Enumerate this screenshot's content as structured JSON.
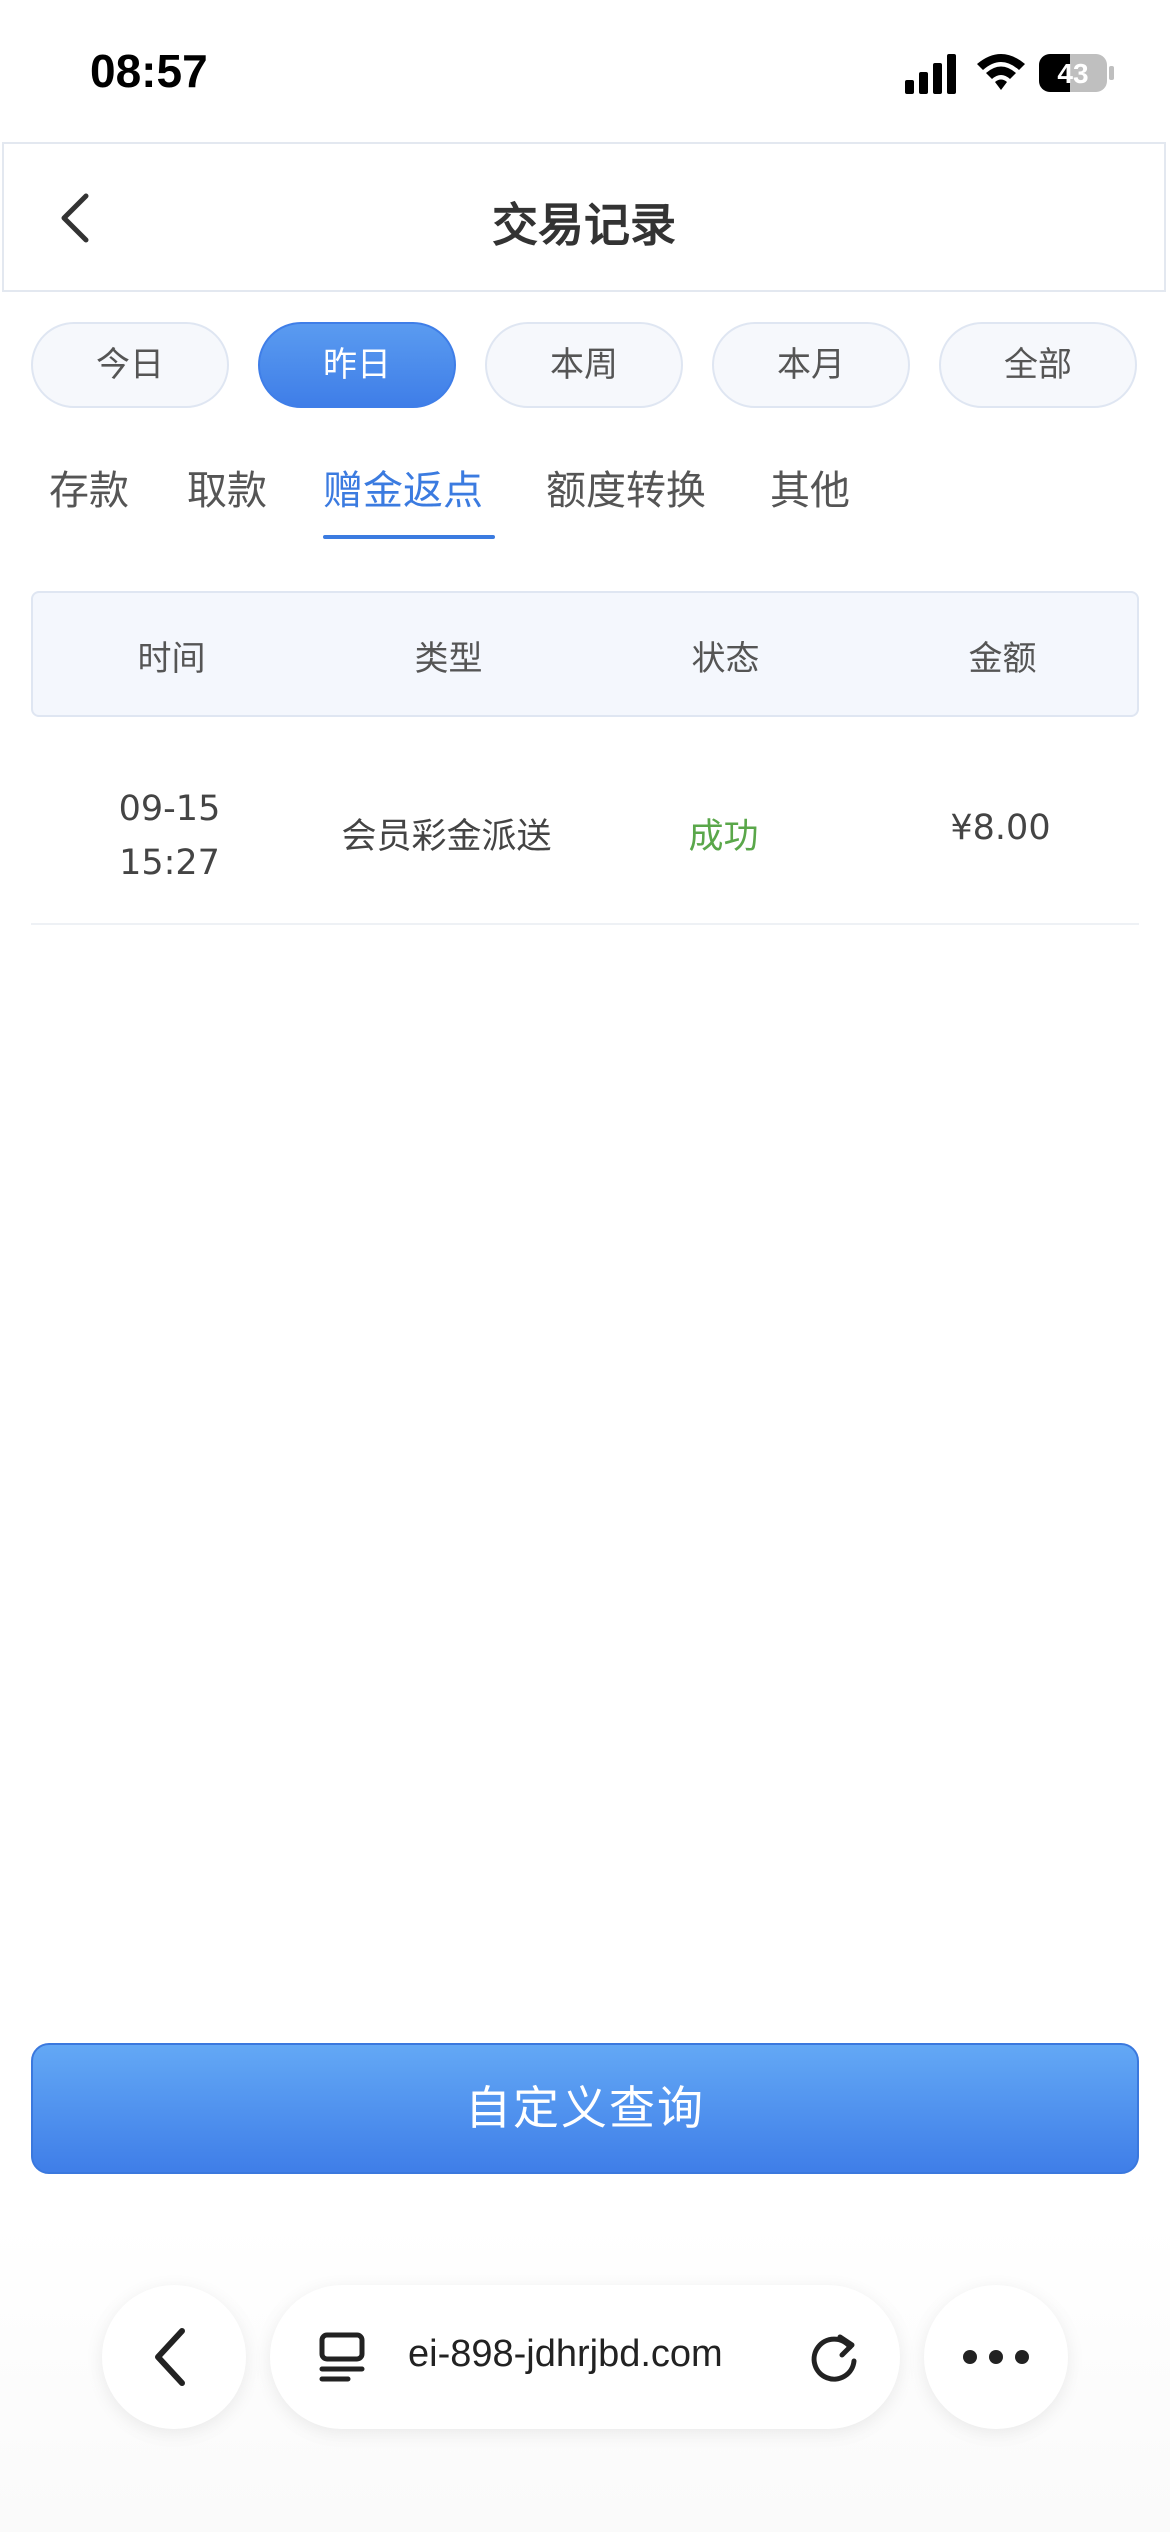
{
  "status_bar": {
    "time": "08:57",
    "battery": "43"
  },
  "header": {
    "title": "交易记录"
  },
  "date_filters": [
    {
      "label": "今日",
      "active": false
    },
    {
      "label": "昨日",
      "active": true
    },
    {
      "label": "本周",
      "active": false
    },
    {
      "label": "本月",
      "active": false
    },
    {
      "label": "全部",
      "active": false
    }
  ],
  "tabs": [
    {
      "label": "存款",
      "active": false
    },
    {
      "label": "取款",
      "active": false
    },
    {
      "label": "赠金返点",
      "active": true
    },
    {
      "label": "额度转换",
      "active": false
    },
    {
      "label": "其他",
      "active": false
    }
  ],
  "table": {
    "columns": [
      "时间",
      "类型",
      "状态",
      "金额"
    ],
    "rows": [
      {
        "date": "09-15",
        "time": "15:27",
        "type": "会员彩金派送",
        "status": "成功",
        "amount": "¥8.00"
      }
    ]
  },
  "query_button": {
    "label": "自定义查询"
  },
  "browser": {
    "url": "ei-898-jdhrjbd.com"
  },
  "colors": {
    "accent": "#3f7ee8",
    "success": "#5aa74a"
  }
}
